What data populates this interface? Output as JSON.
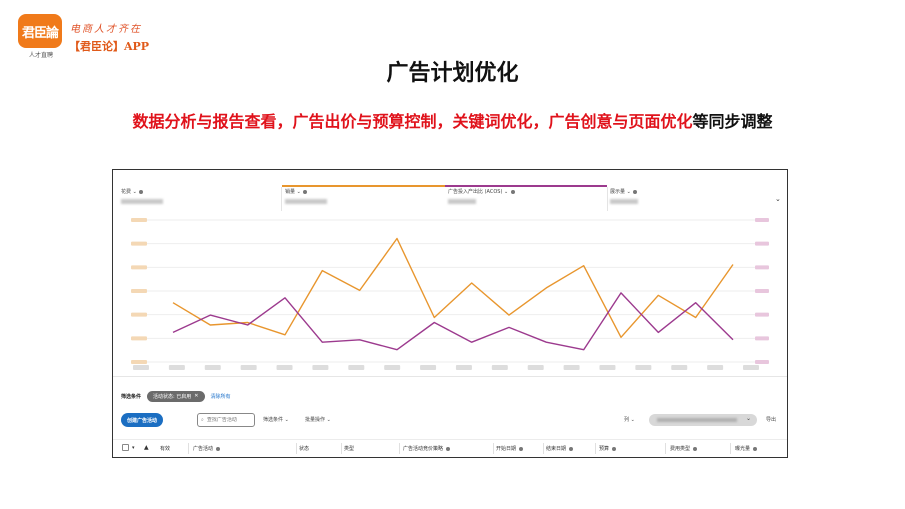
{
  "brand": {
    "logo_text": "君臣論",
    "logo_sub": "人才直聘",
    "slogan": "电商人才齐在",
    "app_name": "【君臣论】APP",
    "accent": "#f07a1a"
  },
  "page": {
    "title": "广告计划优化",
    "subtitle_red": "数据分析与报告查看，广告出价与预算控制，关键词优化，广告创意与页面优化",
    "subtitle_black": "等同步调整"
  },
  "metrics": [
    {
      "label": "花费",
      "accent": ""
    },
    {
      "label": "销量",
      "accent": "#e8962e"
    },
    {
      "label": "广告投入产出比 (ACOS)",
      "accent": "#9c3a8e"
    },
    {
      "label": "展示量",
      "accent": ""
    }
  ],
  "icons": {
    "chevron": "⌄",
    "info": "info-icon",
    "close": "✕",
    "search": "⌕",
    "collapse": "⌄"
  },
  "chart_data": {
    "type": "line",
    "x": [
      1,
      2,
      3,
      4,
      5,
      6,
      7,
      8,
      9,
      10,
      11,
      12,
      13,
      14,
      15,
      16,
      17,
      18
    ],
    "series": [
      {
        "values": [
          48,
          30,
          32,
          22,
          74,
          58,
          100,
          36,
          64,
          38,
          60,
          78,
          20,
          54,
          36,
          79
        ],
        "color": "#e8962e"
      },
      {
        "values": [
          24,
          38,
          30,
          52,
          16,
          18,
          10,
          32,
          16,
          28,
          16,
          10,
          56,
          24,
          48,
          18
        ],
        "color": "#9c3a8e"
      }
    ],
    "ylim": [
      0,
      115
    ],
    "grid": true
  },
  "table": {
    "filter_label": "筛选条件",
    "filter_chip": "活动状态: 已启用",
    "clear_all": "清除所有",
    "create_button": "创建广告活动",
    "search_placeholder": "查找广告活动",
    "filter_dd": "筛选条件",
    "bulk_dd": "批量操作",
    "columns_dd": "列",
    "export": "导出",
    "columns": [
      "有效",
      "广告活动",
      "状态",
      "类型",
      "广告活动竞价策略",
      "开始日期",
      "结束日期",
      "预算",
      "费用类型",
      "曝光量"
    ],
    "accent": "#1b6ec2"
  }
}
